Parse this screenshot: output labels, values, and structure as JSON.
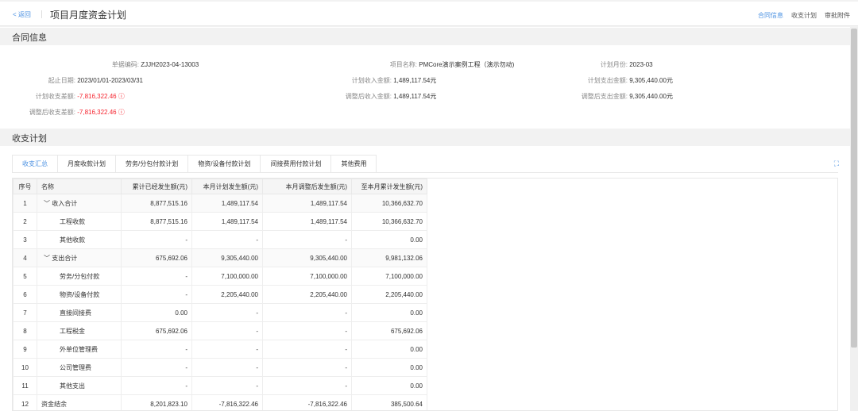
{
  "header": {
    "back": "< 返回",
    "title": "项目月度资金计划",
    "nav": [
      "合同信息",
      "收支计划",
      "审批附件"
    ]
  },
  "contract": {
    "section_title": "合同信息",
    "fields": [
      {
        "label": "单据编码:",
        "value": "ZJJH2023-04-13003"
      },
      {
        "label": "项目名称:",
        "value": "PMCore演示案例工程（演示勿动)"
      },
      {
        "label": "计划月份:",
        "value": "2023-03"
      },
      {
        "label": "起止日期:",
        "value": "2023/01/01-2023/03/31"
      },
      {
        "label": "计划收入金额:",
        "value": "1,489,117.54元"
      },
      {
        "label": "计划支出金额:",
        "value": "9,305,440.00元"
      },
      {
        "label": "计划收支差额:",
        "value": "-7,816,322.46 ⓘ"
      },
      {
        "label": "调整后收入金额:",
        "value": "1,489,117.54元"
      },
      {
        "label": "调整后支出金额:",
        "value": "9,305,440.00元"
      },
      {
        "label": "调整后收支差额:",
        "value": "-7,816,322.46 ⓘ"
      }
    ]
  },
  "plan": {
    "section_title": "收支计划",
    "tabs": [
      "收支汇总",
      "月度收款计划",
      "劳务/分包付款计划",
      "物资/设备付款计划",
      "间接费用付款计划",
      "其他费用"
    ],
    "columns": [
      "序号",
      "名称",
      "累计已经发生额(元)",
      "本月计划发生额(元)",
      "本月调整后发生额(元)",
      "至本月累计发生额(元)"
    ],
    "rows": [
      [
        "1",
        "﹀ 收入合计",
        "8,877,515.16",
        "1,489,117.54",
        "1,489,117.54",
        "10,366,632.70"
      ],
      [
        "2",
        "工程收款",
        "8,877,515.16",
        "1,489,117.54",
        "1,489,117.54",
        "10,366,632.70"
      ],
      [
        "3",
        "其他收款",
        "-",
        "-",
        "-",
        "0.00"
      ],
      [
        "4",
        "﹀ 支出合计",
        "675,692.06",
        "9,305,440.00",
        "9,305,440.00",
        "9,981,132.06"
      ],
      [
        "5",
        "劳务/分包付款",
        "-",
        "7,100,000.00",
        "7,100,000.00",
        "7,100,000.00"
      ],
      [
        "6",
        "物资/设备付款",
        "-",
        "2,205,440.00",
        "2,205,440.00",
        "2,205,440.00"
      ],
      [
        "7",
        "直接间接费",
        "0.00",
        "-",
        "-",
        "0.00"
      ],
      [
        "8",
        "工程税金",
        "675,692.06",
        "-",
        "-",
        "675,692.06"
      ],
      [
        "9",
        "外单位管理费",
        "-",
        "-",
        "-",
        "0.00"
      ],
      [
        "10",
        "公司管理费",
        "-",
        "-",
        "-",
        "0.00"
      ],
      [
        "11",
        "其他支出",
        "-",
        "-",
        "-",
        "0.00"
      ],
      [
        "12",
        "资金结余",
        "8,201,823.10",
        "-7,816,322.46",
        "-7,816,322.46",
        "385,500.64"
      ]
    ]
  }
}
